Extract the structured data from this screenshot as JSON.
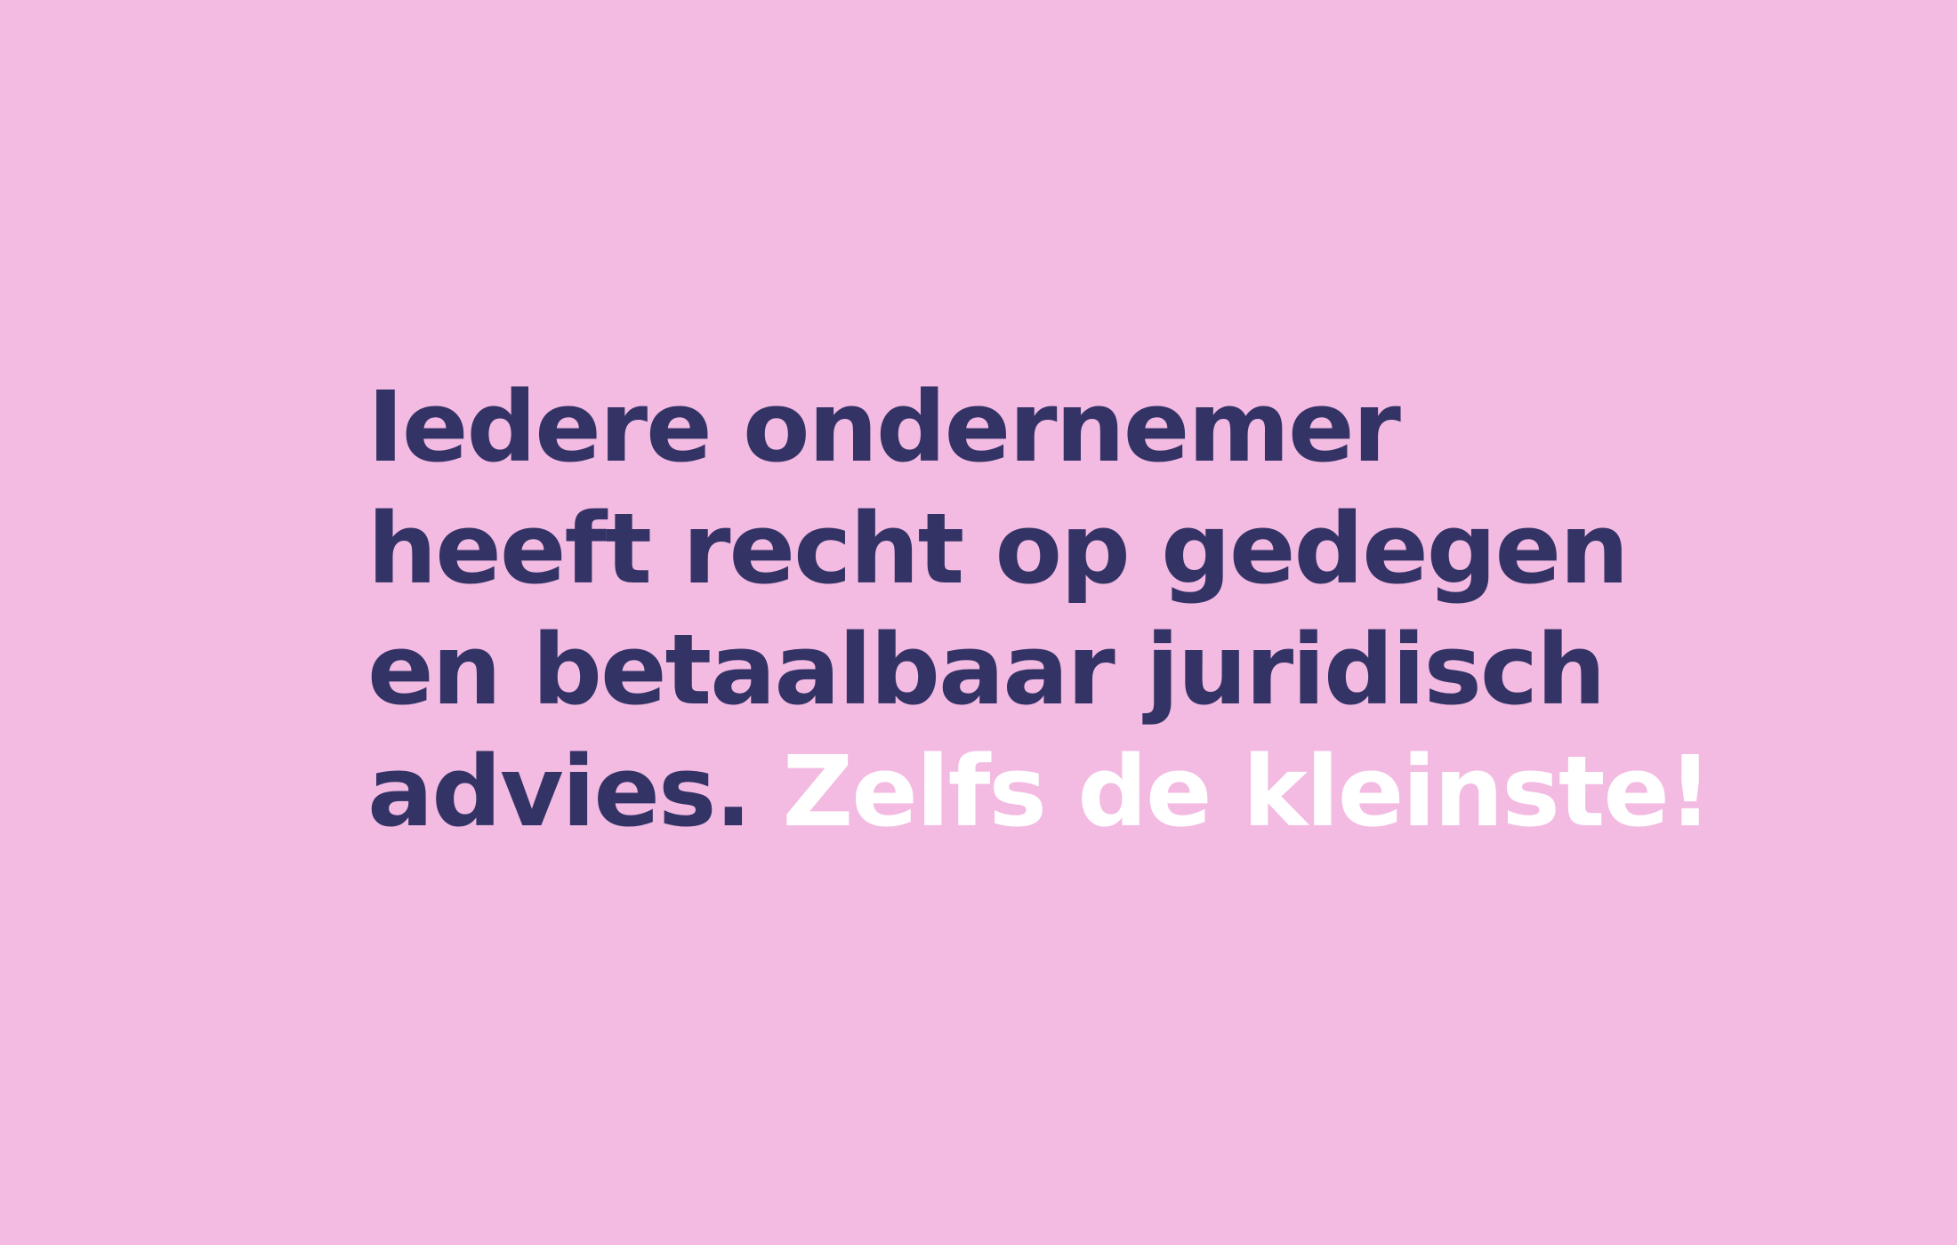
{
  "colors": {
    "background": "#f3bae2",
    "text": "#333366",
    "highlight": "#ffffff"
  },
  "statement": {
    "line1": "Iedere ondernemer",
    "line2": "heeft recht op gedegen",
    "line3": "en betaalbaar juridisch",
    "line4_text": "advies.",
    "line4_highlight": "Zelfs de kleinste!"
  }
}
